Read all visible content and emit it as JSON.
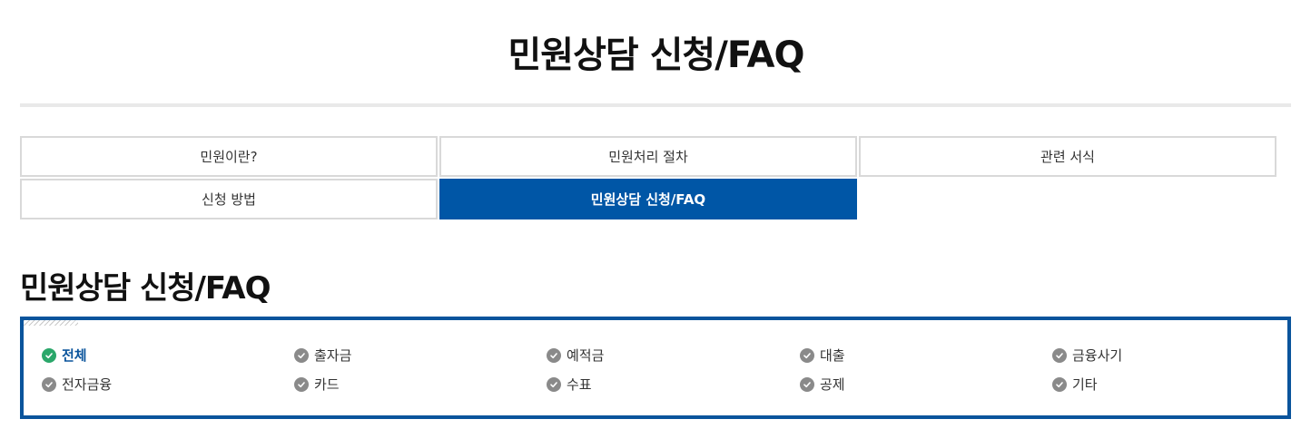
{
  "header": {
    "title": "민원상담 신청/FAQ"
  },
  "tabs": [
    {
      "label": "민원이란?",
      "active": false
    },
    {
      "label": "민원처리 절차",
      "active": false
    },
    {
      "label": "관련 서식",
      "active": false
    },
    {
      "label": "신청 방법",
      "active": false
    },
    {
      "label": "민원상담 신청/FAQ",
      "active": true
    }
  ],
  "section": {
    "title": "민원상담 신청/FAQ"
  },
  "categories": [
    {
      "label": "전체",
      "active": true
    },
    {
      "label": "출자금",
      "active": false
    },
    {
      "label": "예적금",
      "active": false
    },
    {
      "label": "대출",
      "active": false
    },
    {
      "label": "금융사기",
      "active": false
    },
    {
      "label": "전자금융",
      "active": false
    },
    {
      "label": "카드",
      "active": false
    },
    {
      "label": "수표",
      "active": false
    },
    {
      "label": "공제",
      "active": false
    },
    {
      "label": "기타",
      "active": false
    }
  ],
  "colors": {
    "accent": "#0056a6",
    "box_border": "#0a549c",
    "check_active": "#2aa76a",
    "check_inactive": "#8a8a8a"
  },
  "icons": {
    "category_marker": "check-circle-icon"
  }
}
